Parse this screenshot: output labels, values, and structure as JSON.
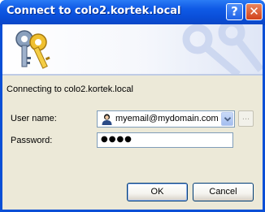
{
  "window": {
    "title": "Connect to colo2.kortek.local",
    "help_label": "?",
    "close_label": "✕"
  },
  "dialog": {
    "message": "Connecting to colo2.kortek.local",
    "username_label": "User name:",
    "username_value": "myemail@mydomain.com",
    "browse_label": "...",
    "password_label": "Password:",
    "password_value": "●●●●",
    "ok_label": "OK",
    "cancel_label": "Cancel"
  },
  "icons": {
    "banner": "keys-icon",
    "user": "user-icon"
  },
  "colors": {
    "titlebar": "#0a4fd6",
    "dialog_bg": "#ece9d8",
    "close_button": "#d2421b"
  }
}
